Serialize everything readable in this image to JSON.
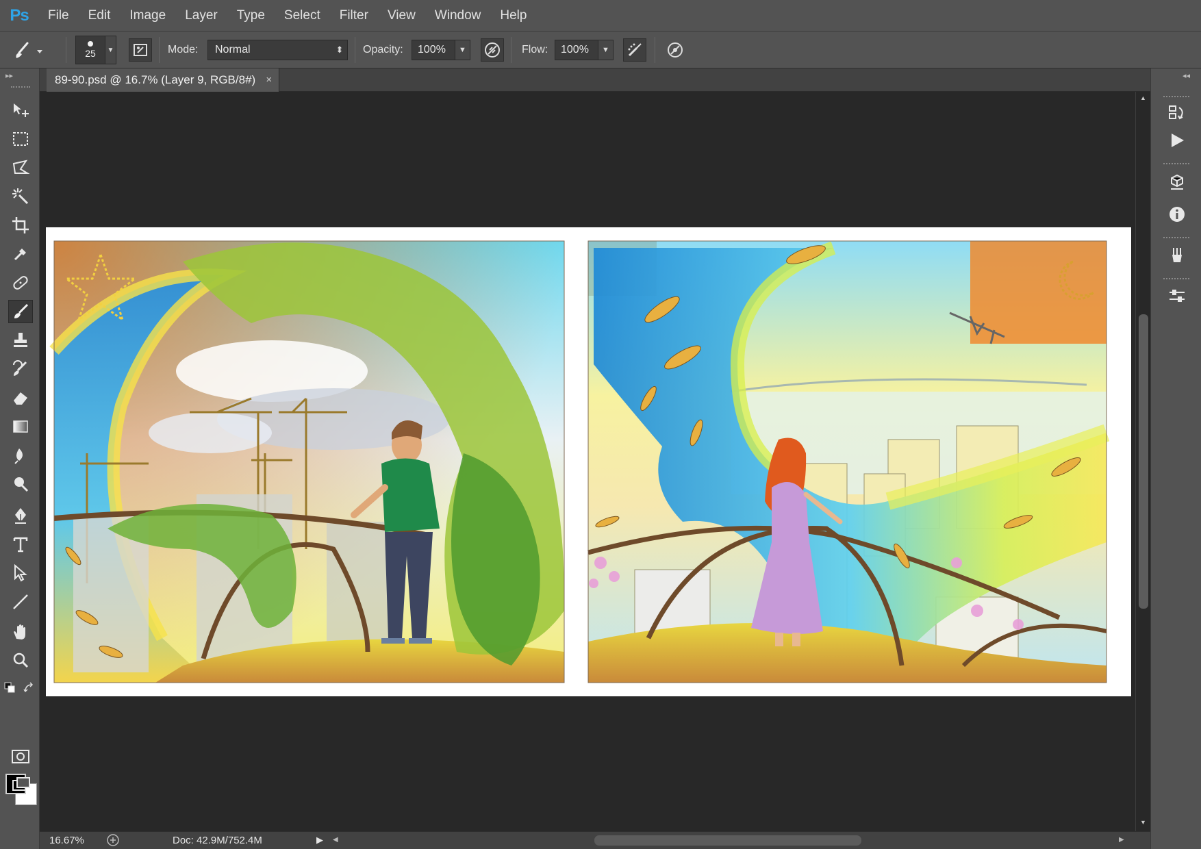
{
  "app": {
    "logo": "Ps"
  },
  "menu": [
    "File",
    "Edit",
    "Image",
    "Layer",
    "Type",
    "Select",
    "Filter",
    "View",
    "Window",
    "Help"
  ],
  "options": {
    "brush_size": "25",
    "mode_label": "Mode:",
    "mode_value": "Normal",
    "opacity_label": "Opacity:",
    "opacity_value": "100%",
    "flow_label": "Flow:",
    "flow_value": "100%"
  },
  "document": {
    "tab_title": "89-90.psd @ 16.7% (Layer 9, RGB/8#)",
    "close_glyph": "×"
  },
  "status": {
    "zoom": "16.67%",
    "doc_size": "Doc: 42.9M/752.4M"
  },
  "tools": [
    "move-icon",
    "marquee-icon",
    "lasso-icon",
    "magic-wand-icon",
    "crop-icon",
    "eyedropper-icon",
    "healing-brush-icon",
    "brush-icon",
    "clone-stamp-icon",
    "history-brush-icon",
    "eraser-icon",
    "gradient-icon",
    "blur-icon",
    "dodge-icon",
    "pen-icon",
    "type-icon",
    "path-selection-icon",
    "line-icon",
    "hand-icon",
    "zoom-icon"
  ],
  "colors": {
    "foreground": "#000000",
    "background": "#ffffff",
    "ps_blue": "#2fa3e6"
  }
}
